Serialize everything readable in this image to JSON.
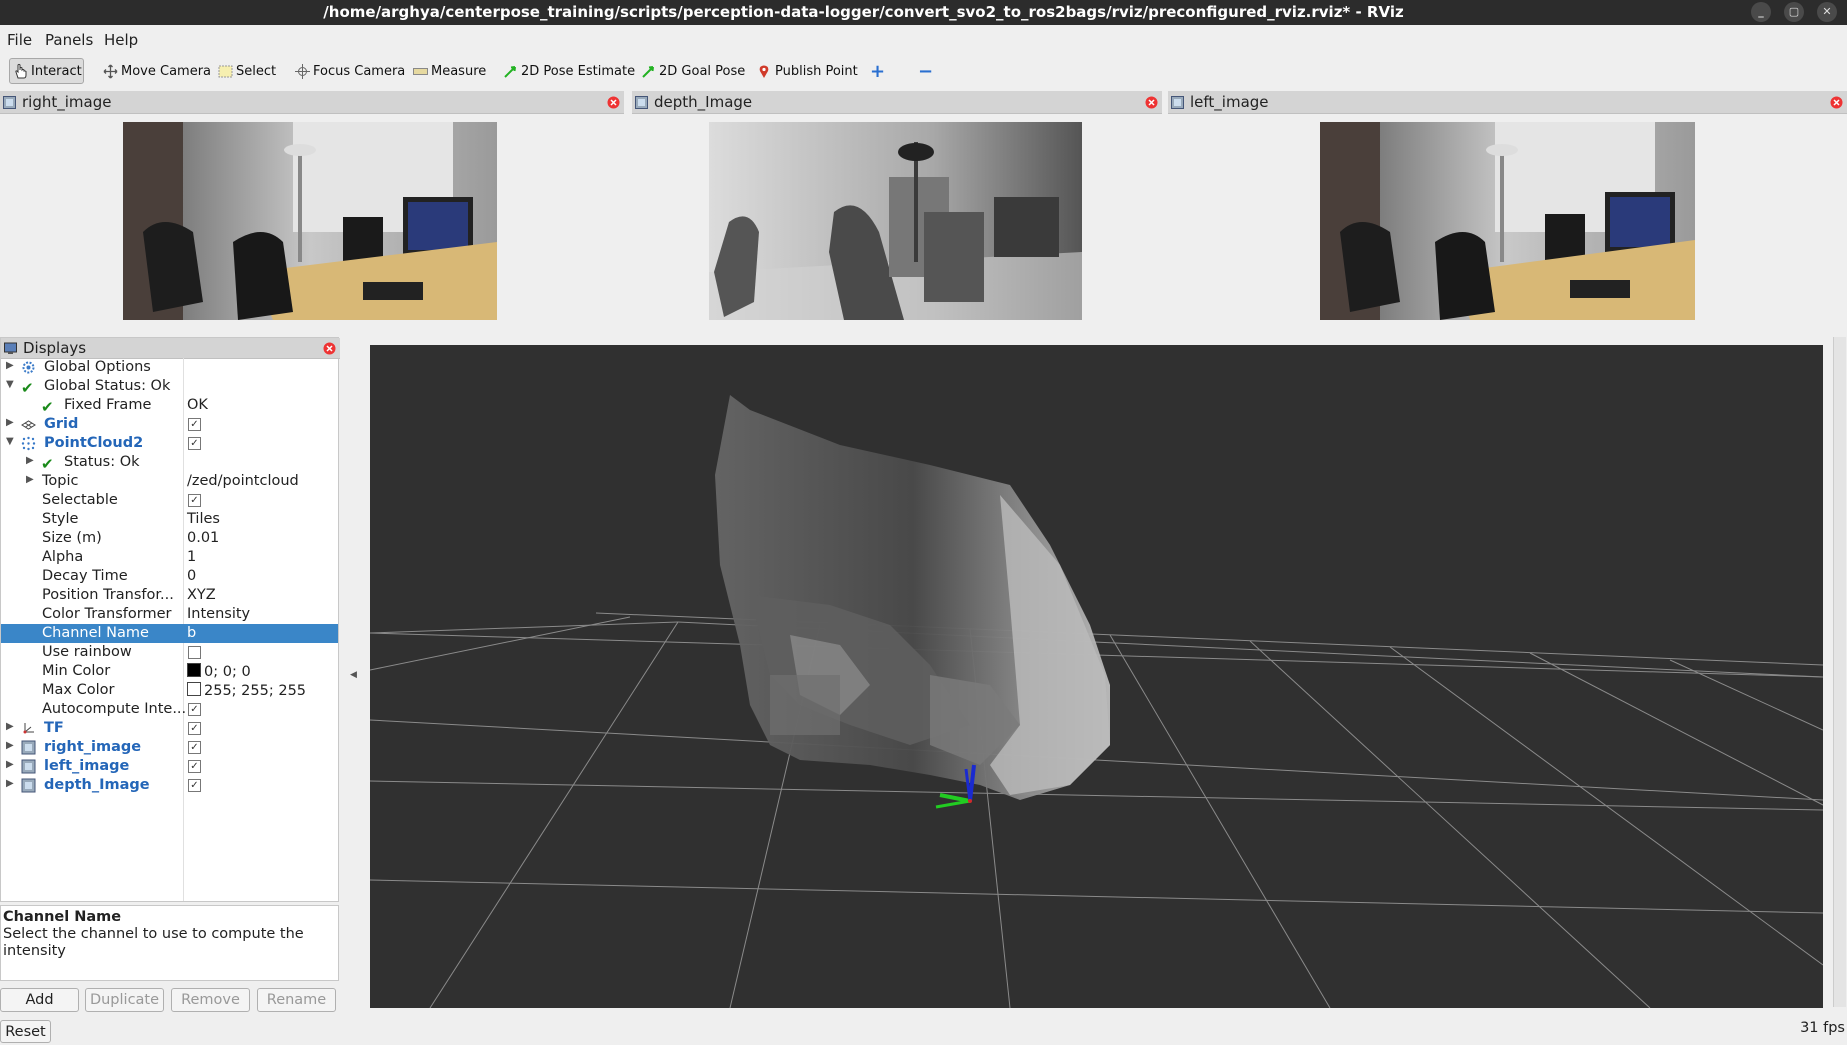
{
  "window": {
    "title": "/home/arghya/centerpose_training/scripts/perception-data-logger/convert_svo2_to_ros2bags/rviz/preconfigured_rviz.rviz* - RViz",
    "controls": [
      "_",
      "▢",
      "✕"
    ]
  },
  "menu": {
    "file": "File",
    "panels": "Panels",
    "help": "Help"
  },
  "toolbar": {
    "interact": "Interact",
    "move_camera": "Move Camera",
    "select": "Select",
    "focus_camera": "Focus Camera",
    "measure": "Measure",
    "pose_estimate": "2D Pose Estimate",
    "goal_pose": "2D Goal Pose",
    "publish_point": "Publish Point",
    "add_tool": "+",
    "remove_tool": "−"
  },
  "image_panels": {
    "right": "right_image",
    "depth": "depth_Image",
    "left": "left_image"
  },
  "displays": {
    "title": "Displays",
    "rows": {
      "global_options": "Global Options",
      "global_status": "Global Status: Ok",
      "fixed_frame": "Fixed Frame",
      "fixed_frame_val": "OK",
      "grid": "Grid",
      "pointcloud2": "PointCloud2",
      "status": "Status: Ok",
      "topic": "Topic",
      "topic_val": "/zed/pointcloud",
      "selectable": "Selectable",
      "style": "Style",
      "style_val": "Tiles",
      "size": "Size (m)",
      "size_val": "0.01",
      "alpha": "Alpha",
      "alpha_val": "1",
      "decay": "Decay Time",
      "decay_val": "0",
      "position_transformer": "Position Transfor...",
      "position_transformer_val": "XYZ",
      "color_transformer": "Color Transformer",
      "color_transformer_val": "Intensity",
      "channel_name": "Channel Name",
      "channel_name_val": "b",
      "use_rainbow": "Use rainbow",
      "min_color": "Min Color",
      "min_color_val": "0; 0; 0",
      "max_color": "Max Color",
      "max_color_val": "255; 255; 255",
      "autocompute": "Autocompute Inte...",
      "tf": "TF",
      "right_image": "right_image",
      "left_image": "left_image",
      "depth_image": "depth_Image"
    },
    "colors": {
      "min": "#000000",
      "max": "#ffffff",
      "selection": "#3a86c8"
    }
  },
  "description": {
    "name": "Channel Name",
    "text": "Select the channel to use to compute the intensity"
  },
  "buttons": {
    "add": "Add",
    "duplicate": "Duplicate",
    "remove": "Remove",
    "rename": "Rename",
    "reset": "Reset"
  },
  "status": {
    "fps": "31 fps"
  }
}
